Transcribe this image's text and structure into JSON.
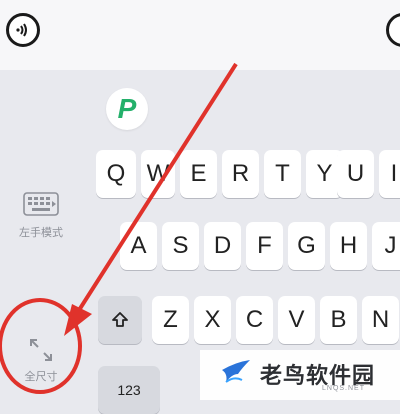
{
  "input_bar": {
    "voice_icon": "voice-wave-icon"
  },
  "logo": {
    "text": "P",
    "color": "#23b06a"
  },
  "keyboard": {
    "row1": [
      "Q",
      "W",
      "E",
      "R",
      "T",
      "Y",
      "U",
      "I"
    ],
    "row2": [
      "A",
      "S",
      "D",
      "F",
      "G",
      "H",
      "J"
    ],
    "row3": [
      "Z",
      "X",
      "C",
      "V",
      "B",
      "N"
    ],
    "numbers_key": "123",
    "shift_icon": "shift-arrow-icon"
  },
  "side_panel": {
    "left_hand_mode_label": "左手模式",
    "full_size_label": "全尺寸"
  },
  "annotation": {
    "color": "#e0322b"
  },
  "watermark": {
    "title": "老鸟软件园",
    "subtitle": "LNQS.NET"
  }
}
